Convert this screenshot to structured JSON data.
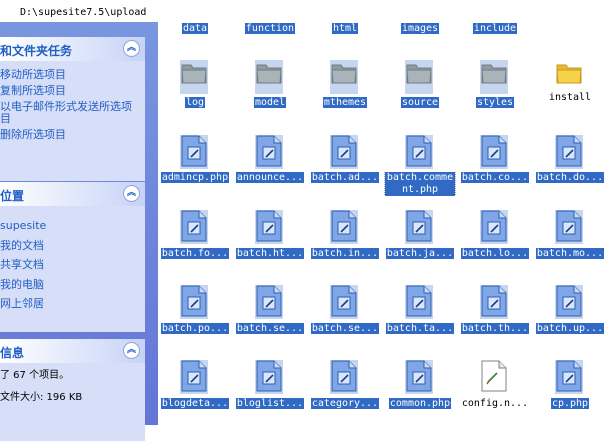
{
  "address": {
    "path": "D:\\supesite7.5\\upload"
  },
  "tasks_panel": {
    "title": "和文件夹任务",
    "items": [
      "移动所选项目",
      "复制所选项目",
      "以电子邮件形式发送所选项目",
      "删除所选项目"
    ]
  },
  "places_panel": {
    "title": "位置",
    "items": [
      "supesite",
      "我的文档",
      "共享文档",
      "我的电脑",
      "网上邻居"
    ]
  },
  "details_panel": {
    "title": "信息",
    "lines": [
      "了 67 个项目。",
      "文件大小: 196 KB"
    ]
  },
  "collapse_glyph": "︽",
  "files": {
    "row0": [
      "data",
      "function",
      "html",
      "images",
      "include"
    ],
    "row1": [
      {
        "name": "log",
        "selected": true
      },
      {
        "name": "model",
        "selected": true
      },
      {
        "name": "mthemes",
        "selected": true
      },
      {
        "name": "source",
        "selected": true
      },
      {
        "name": "styles",
        "selected": true
      },
      {
        "name": "install",
        "selected": false
      }
    ],
    "row2": [
      "admincp.php",
      "announce...",
      "batch.ad...",
      "batch.comment.php",
      "batch.co...",
      "batch.do..."
    ],
    "row3": [
      "batch.fo...",
      "batch.ht...",
      "batch.in...",
      "batch.ja...",
      "batch.lo...",
      "batch.mo..."
    ],
    "row4": [
      "batch.po...",
      "batch.se...",
      "batch.se...",
      "batch.ta...",
      "batch.th...",
      "batch.up..."
    ],
    "row5": [
      {
        "name": "blogdeta...",
        "selected": true
      },
      {
        "name": "bloglist...",
        "selected": true
      },
      {
        "name": "category...",
        "selected": true
      },
      {
        "name": "common.php",
        "selected": true
      },
      {
        "name": "config.n...",
        "selected": false
      },
      {
        "name": "cp.php",
        "selected": true
      }
    ]
  },
  "colors": {
    "selection": "#316ac5",
    "pane": "#6b86d6",
    "link": "#215dc6"
  }
}
